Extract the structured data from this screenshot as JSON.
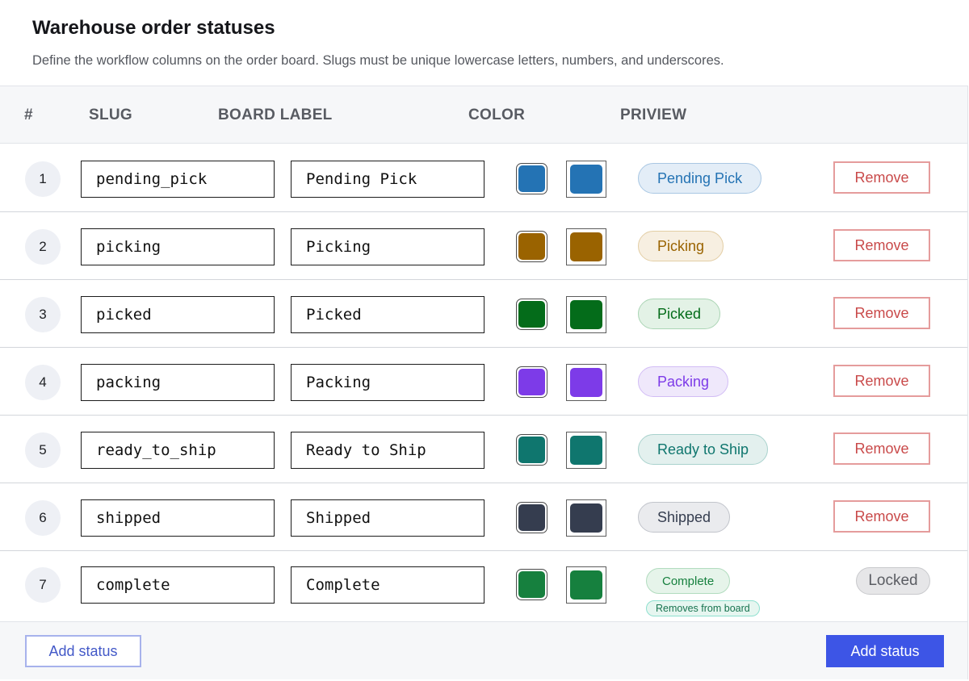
{
  "page": {
    "title": "Warehouse order statuses",
    "subtitle": "Define the workflow columns on the order board. Slugs must be unique lowercase letters, numbers, and underscores."
  },
  "table": {
    "headers": {
      "index": "#",
      "slug": "SLUG",
      "board_label": "BOARD LABEL",
      "color": "COLOR",
      "preview": "PRIVIEW"
    },
    "rows": [
      {
        "index": "1",
        "slug": "pending_pick",
        "label": "Pending Pick",
        "color": "#2473b4",
        "preview": "Pending Pick",
        "preview_bg": "#e3edf7",
        "preview_border": "#a9c7e3",
        "preview_text": "#2473b4",
        "action": "Remove"
      },
      {
        "index": "2",
        "slug": "picking",
        "label": "Picking",
        "color": "#9a6300",
        "preview": "Picking",
        "preview_bg": "#f7efe1",
        "preview_border": "#e3cea5",
        "preview_text": "#9a6300",
        "action": "Remove"
      },
      {
        "index": "3",
        "slug": "picked",
        "label": "Picked",
        "color": "#046c1a",
        "preview": "Picked",
        "preview_bg": "#e3f2e6",
        "preview_border": "#abd5b5",
        "preview_text": "#046c1a",
        "action": "Remove"
      },
      {
        "index": "4",
        "slug": "packing",
        "label": "Packing",
        "color": "#7d3be8",
        "preview": "Packing",
        "preview_bg": "#efe8fb",
        "preview_border": "#d2bdf5",
        "preview_text": "#7d3be8",
        "action": "Remove"
      },
      {
        "index": "5",
        "slug": "ready_to_ship",
        "label": "Ready to Ship",
        "color": "#0f766e",
        "preview": "Ready to Ship",
        "preview_bg": "#e3f0ee",
        "preview_border": "#a9d2cd",
        "preview_text": "#0f766e",
        "action": "Remove"
      },
      {
        "index": "6",
        "slug": "shipped",
        "label": "Shipped",
        "color": "#353d4f",
        "preview": "Shipped",
        "preview_bg": "#eaebee",
        "preview_border": "#c1c4cb",
        "preview_text": "#353d4f",
        "action": "Remove"
      }
    ],
    "last_row": {
      "index": "7",
      "slug": "complete",
      "label": "Complete",
      "color": "#16803e",
      "preview": "Complete",
      "preview_bg": "#e6f4ea",
      "preview_border": "#b2dcbf",
      "preview_text": "#16803e",
      "note": "Removes from board",
      "action": "Locked"
    }
  },
  "footer": {
    "add_secondary": "Add status",
    "add_primary": "Add status"
  }
}
